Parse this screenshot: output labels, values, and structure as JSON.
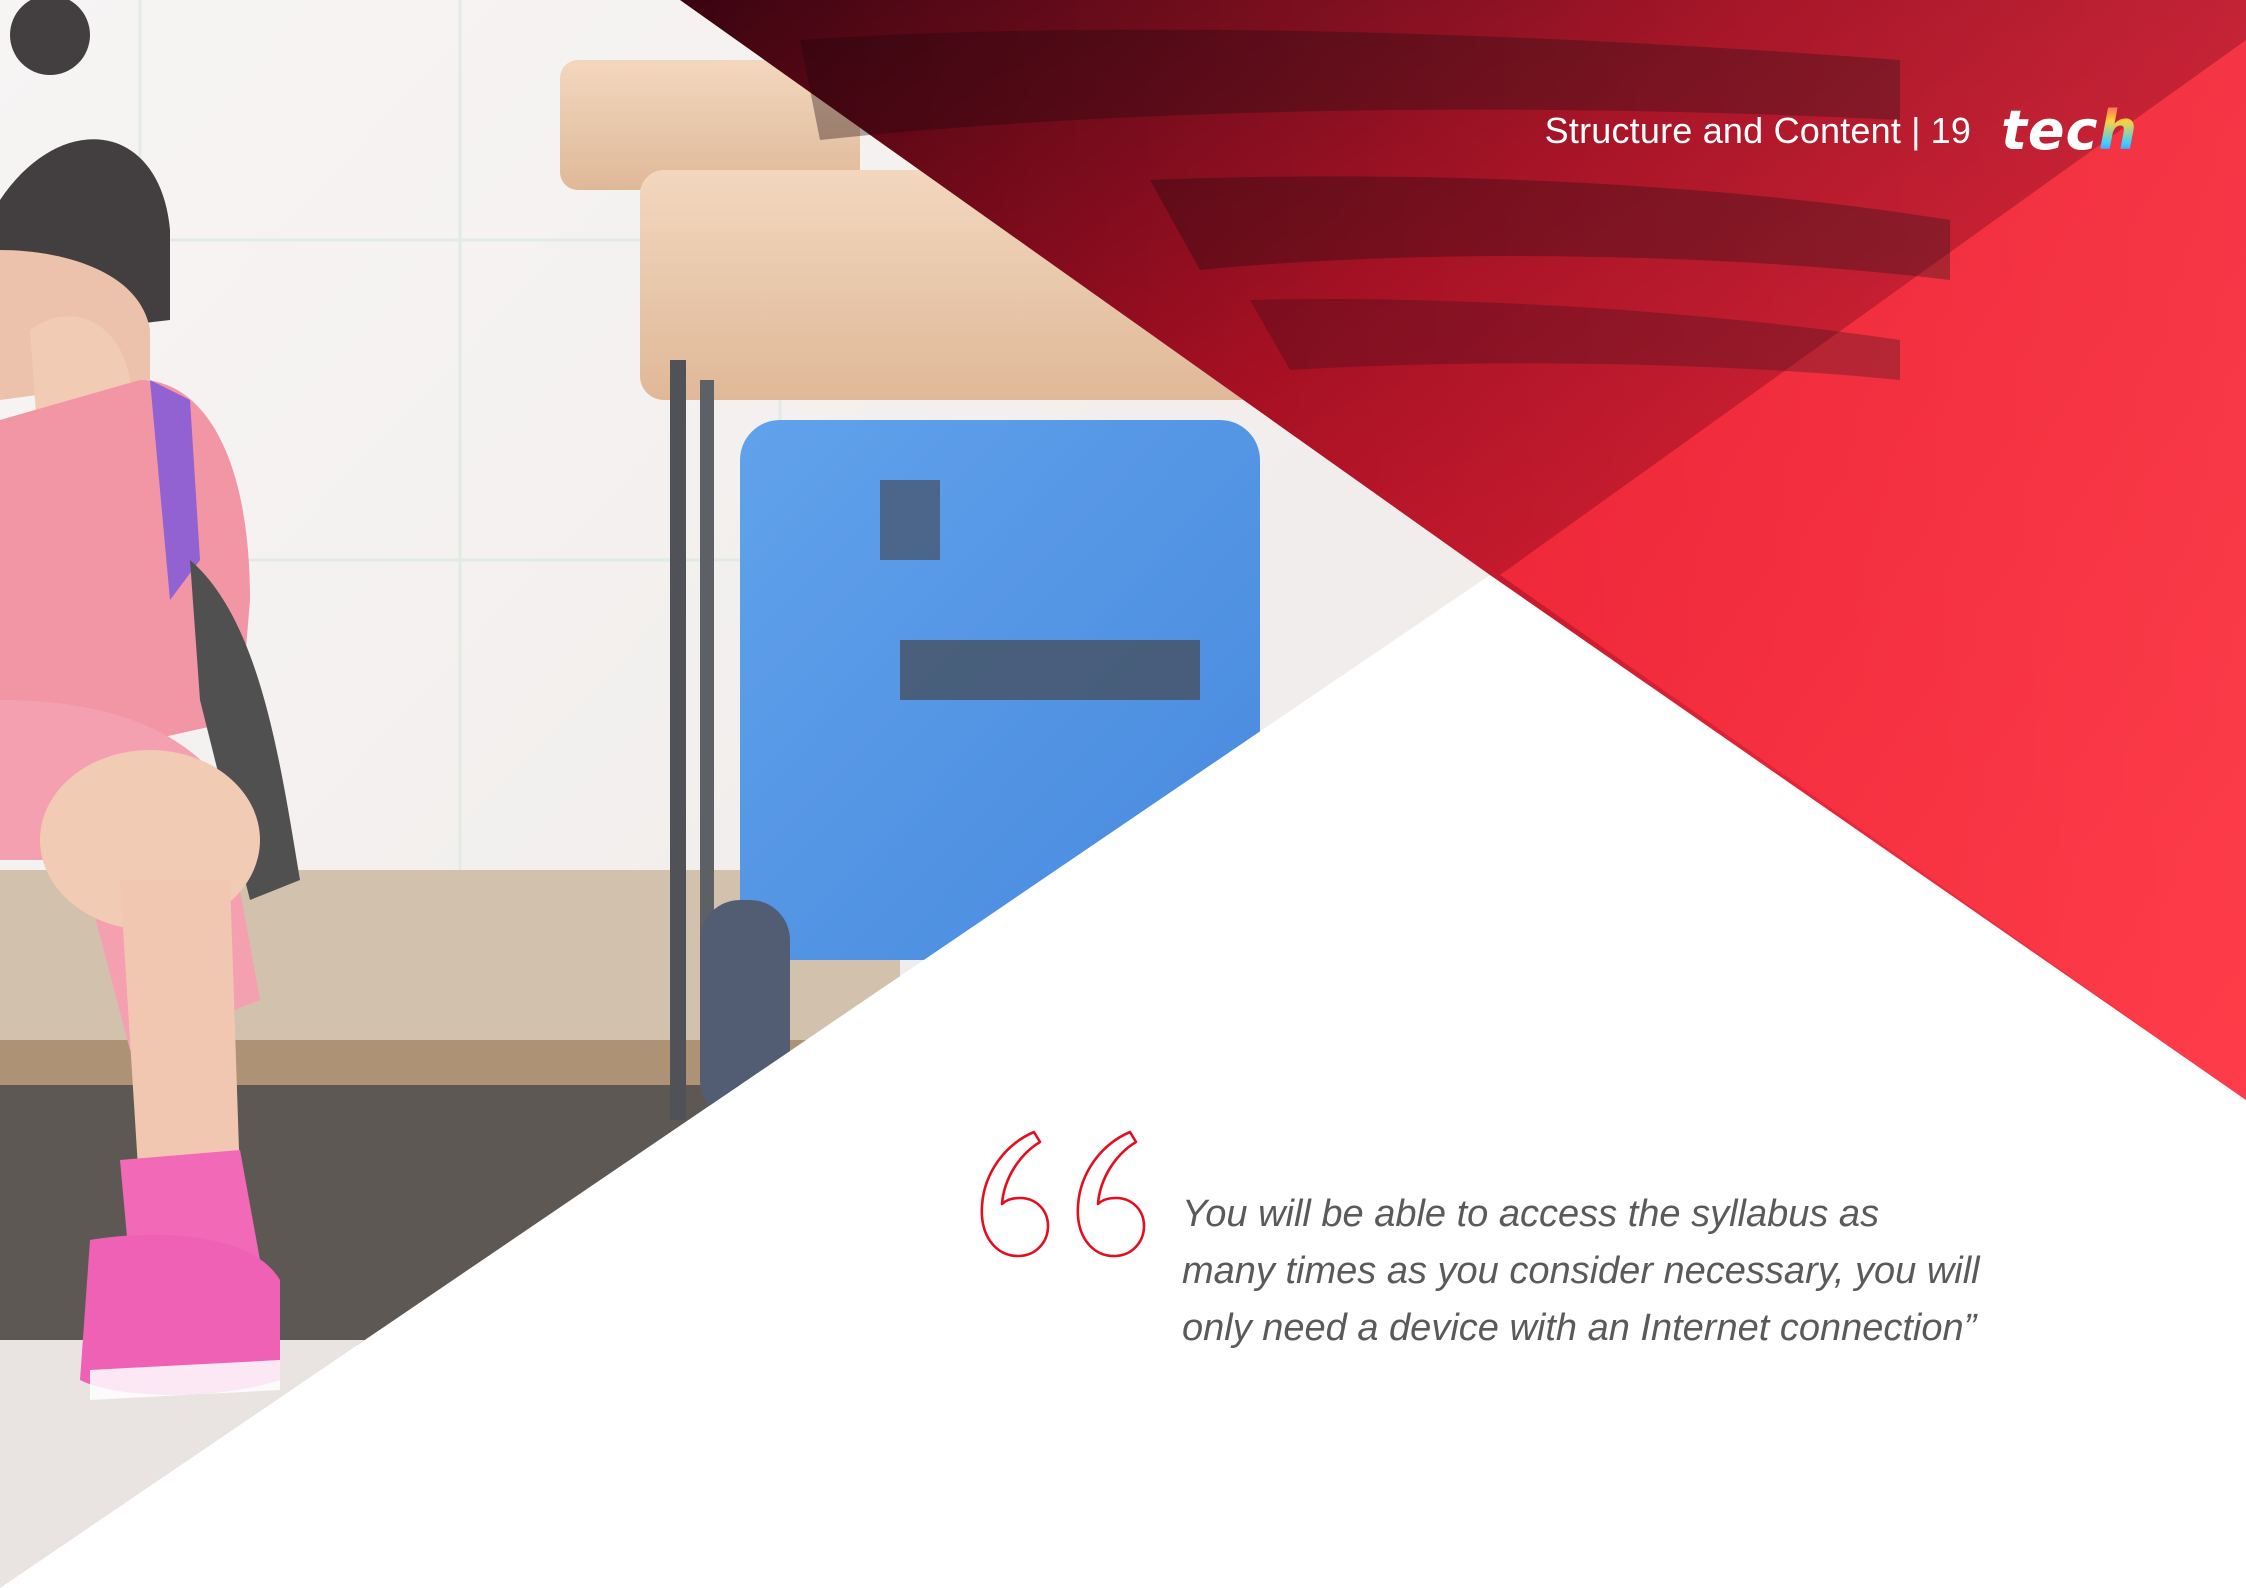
{
  "header": {
    "section_title": "Structure and Content",
    "separator": "|",
    "page_number": "19",
    "logo_text_main": "tec",
    "logo_text_last": "h"
  },
  "quote": {
    "lines": [
      "You will be able to access the syllabus as",
      "many times as you consider necessary, you will",
      "only need a device with an Internet connection”"
    ]
  },
  "colors": {
    "brand_red": "#f72534",
    "dark_red": "#4a0512",
    "quote_mark_red": "#e01020",
    "quote_text": "#5a5a5a",
    "white": "#ffffff"
  }
}
